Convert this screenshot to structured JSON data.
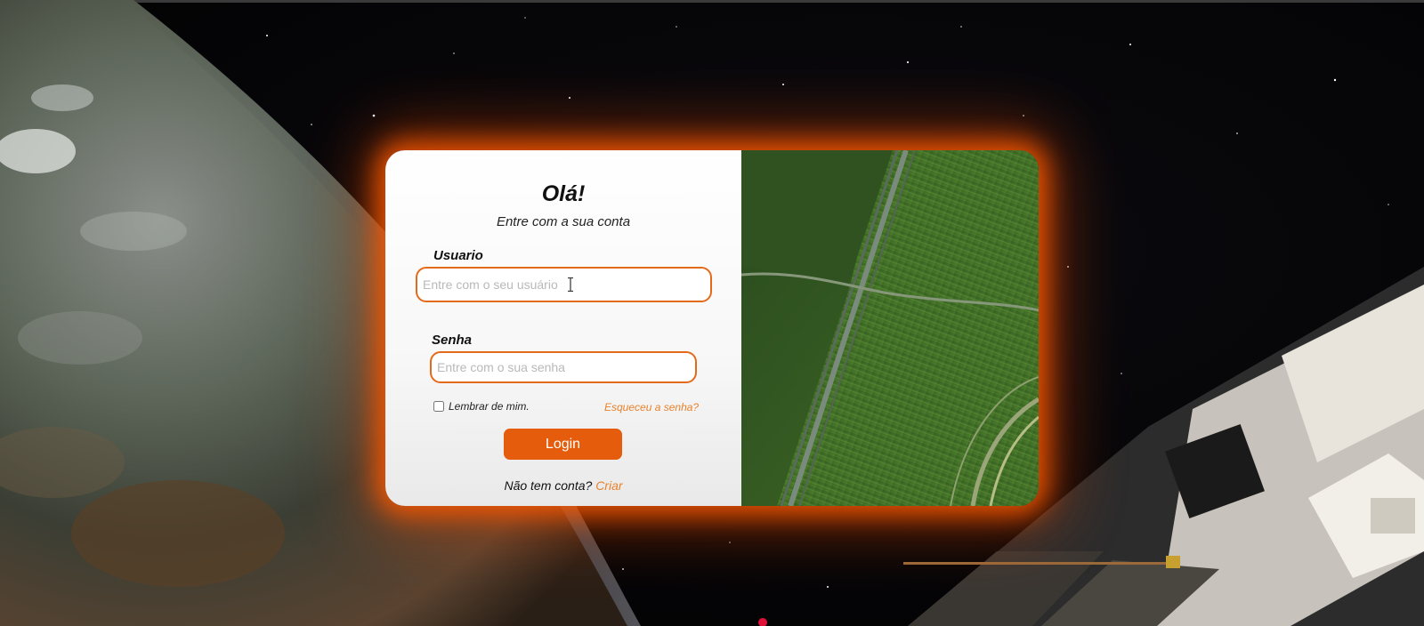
{
  "login": {
    "title": "Olá!",
    "subtitle": "Entre com a sua conta",
    "username_label": "Usuario",
    "username_placeholder": "Entre com o seu usuário",
    "password_label": "Senha",
    "password_placeholder": "Entre com o sua senha",
    "remember_label": "Lembrar de mim.",
    "forgot_link": "Esqueceu a senha?",
    "login_button": "Login",
    "no_account_text": "Não tem conta?",
    "create_link": "Criar"
  },
  "colors": {
    "accent": "#e45c0c",
    "link": "#e8822c",
    "input_border": "#e46a1b",
    "glow": "#ff5a00"
  },
  "images": {
    "background": "space-earth-satellite",
    "side_panel": "aerial-green-fields"
  }
}
